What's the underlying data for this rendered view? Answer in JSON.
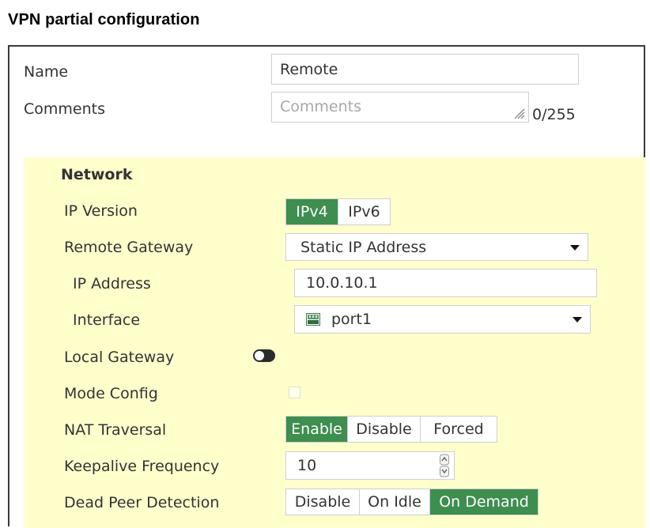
{
  "page": {
    "title": "VPN partial configuration"
  },
  "form": {
    "name": {
      "label": "Name",
      "value": "Remote"
    },
    "comments": {
      "label": "Comments",
      "placeholder": "Comments",
      "counter": "0/255"
    }
  },
  "network": {
    "section_title": "Network",
    "ip_version": {
      "label": "IP Version",
      "options": [
        "IPv4",
        "IPv6"
      ],
      "selected": "IPv4"
    },
    "remote_gateway": {
      "label": "Remote Gateway",
      "value": "Static IP Address"
    },
    "ip_address": {
      "label": "IP Address",
      "value": "10.0.10.1"
    },
    "interface": {
      "label": "Interface",
      "value": "port1",
      "icon": "network-port-icon"
    },
    "local_gateway": {
      "label": "Local Gateway",
      "enabled": false
    },
    "mode_config": {
      "label": "Mode Config",
      "checked": false
    },
    "nat_traversal": {
      "label": "NAT Traversal",
      "options": [
        "Enable",
        "Disable",
        "Forced"
      ],
      "selected": "Enable"
    },
    "keepalive": {
      "label": "Keepalive Frequency",
      "value": "10"
    },
    "dead_peer_detection": {
      "label": "Dead Peer Detection",
      "options": [
        "Disable",
        "On Idle",
        "On Demand"
      ],
      "selected": "On Demand"
    }
  },
  "colors": {
    "accent": "#3d8e4f",
    "panel_background": "#ffffcc",
    "border": "#d0d0d0"
  }
}
